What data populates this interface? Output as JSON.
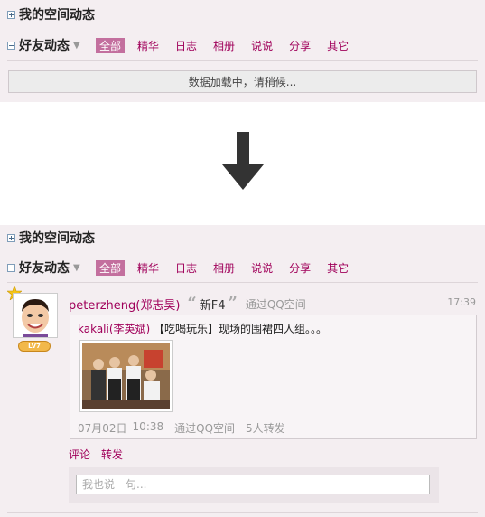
{
  "my_space": {
    "title": "我的空间动态"
  },
  "friends": {
    "title": "好友动态",
    "caret": "▼",
    "tabs": [
      "全部",
      "精华",
      "日志",
      "相册",
      "说说",
      "分享",
      "其它"
    ]
  },
  "loading": {
    "text": "数据加载中，请稍候..."
  },
  "colors": {
    "accent": "#a0005a",
    "active_tab_bg": "#c36f9e",
    "panel_bg": "#f4eef1"
  },
  "feed": {
    "avatar": {
      "level_badge": "LV7"
    },
    "post": {
      "author": "peterzheng(郑志昊)",
      "quote_open": "“",
      "content": "新F4",
      "quote_close": "”",
      "via": "通过QQ空间",
      "time": "17:39"
    },
    "share": {
      "user": "kakali(李英斌)",
      "text": "【吃喝玩乐】现场的围裙四人组。。。",
      "date": "07月02日",
      "time": "10:38",
      "via": "通过QQ空间",
      "reposts": "5人转发"
    },
    "actions": {
      "comment": "评论",
      "repost": "转发"
    },
    "comment_placeholder": "我也说一句..."
  }
}
